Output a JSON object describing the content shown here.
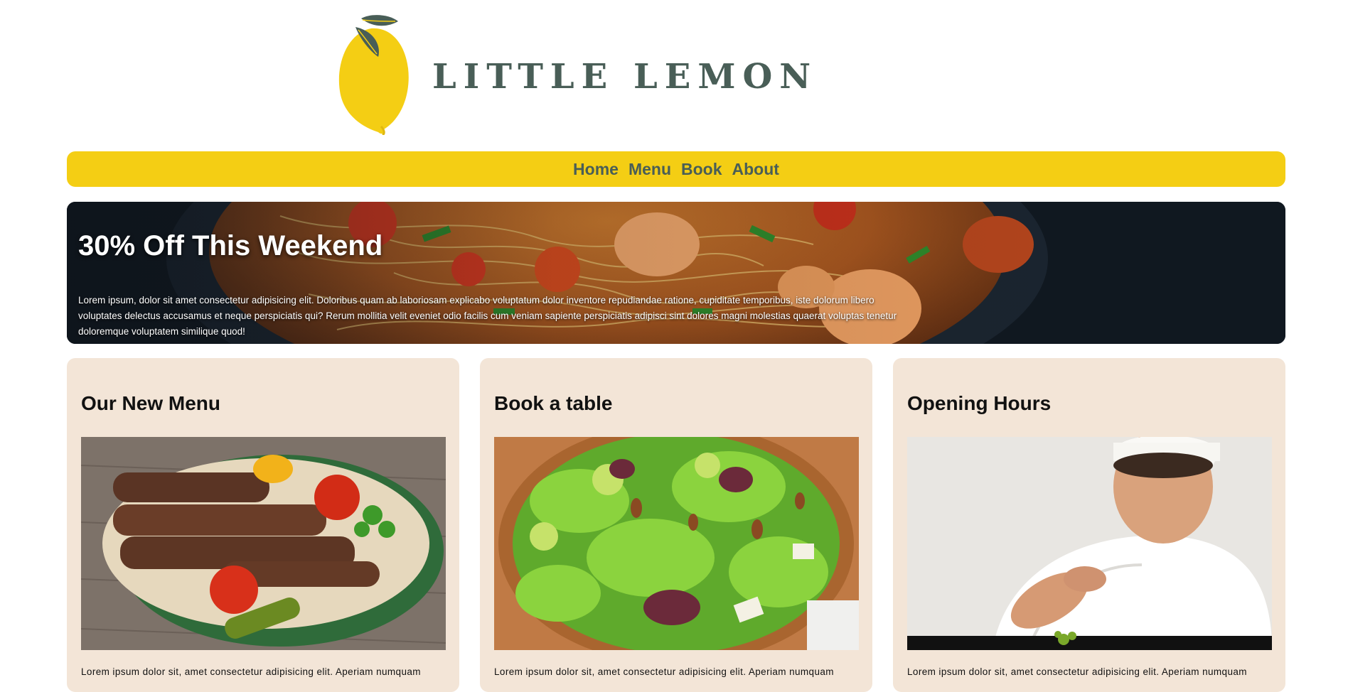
{
  "brand": {
    "name": "LITTLE LEMON",
    "logo_icon": "lemon-icon",
    "colors": {
      "primary_green": "#495e57",
      "yellow": "#f4ce14",
      "card_bg": "#f3e5d7"
    }
  },
  "nav": {
    "items": [
      {
        "label": "Home"
      },
      {
        "label": "Menu"
      },
      {
        "label": "Book"
      },
      {
        "label": "About"
      }
    ]
  },
  "hero": {
    "title": "30% Off This Weekend",
    "body": "Lorem ipsum, dolor sit amet consectetur adipisicing elit. Doloribus quam ab laboriosam explicabo voluptatum dolor inventore repudiandae ratione, cupiditate temporibus, iste dolorum libero voluptates delectus accusamus et neque perspiciatis qui? Rerum mollitia velit eveniet odio facilis cum veniam sapiente perspiciatis adipisci sint dolores magni molestias quaerat voluptas tenetur doloremque voluptatem similique quod!"
  },
  "cards": [
    {
      "title": "Our New Menu",
      "image": "kebab-plate-photo",
      "text": "Lorem ipsum dolor sit, amet consectetur adipisicing elit. Aperiam numquam"
    },
    {
      "title": "Book a table",
      "image": "green-salad-photo",
      "text": "Lorem ipsum dolor sit, amet consectetur adipisicing elit. Aperiam numquam"
    },
    {
      "title": "Opening Hours",
      "image": "chef-plating-photo",
      "text": "Lorem ipsum dolor sit, amet consectetur adipisicing elit. Aperiam numquam"
    }
  ]
}
